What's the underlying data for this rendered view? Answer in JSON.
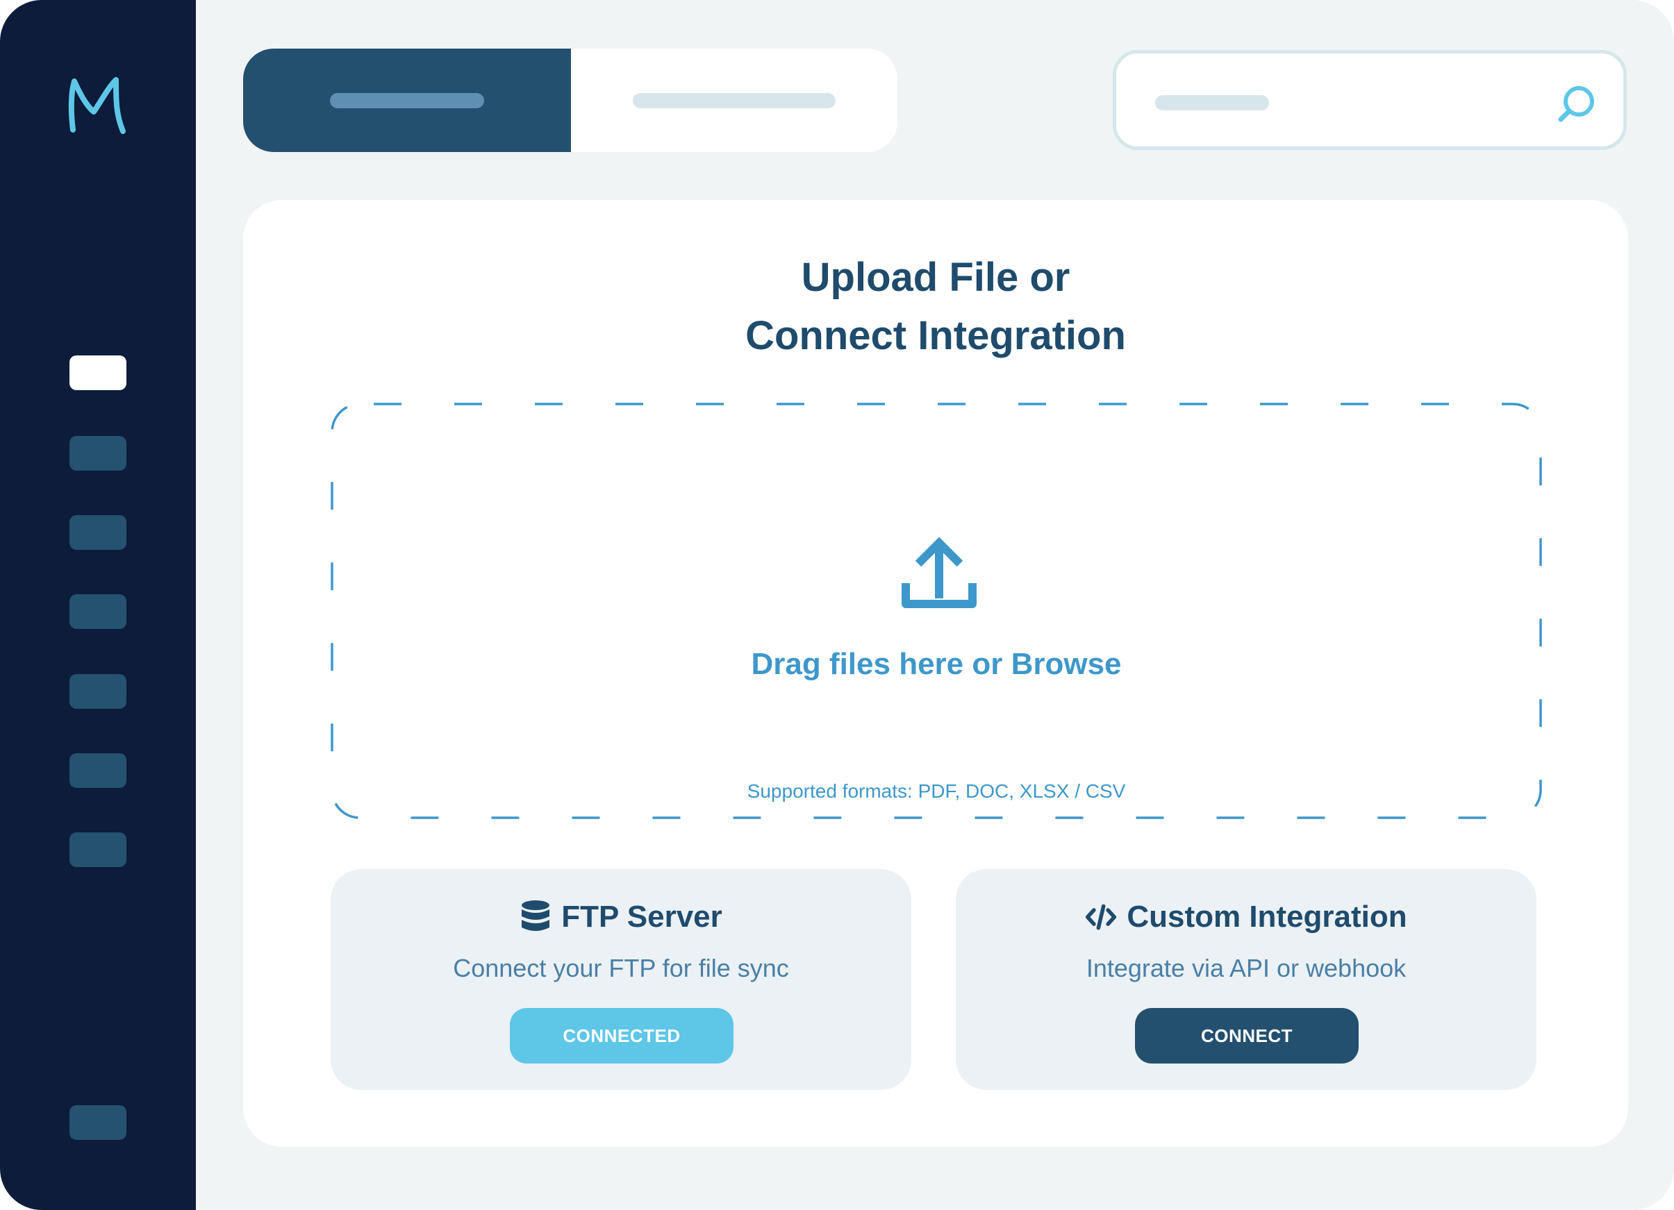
{
  "sidebar": {
    "logo": "M",
    "nav_items": [
      "nav-item-1",
      "nav-item-2",
      "nav-item-3",
      "nav-item-4",
      "nav-item-5",
      "nav-item-6",
      "nav-item-7",
      "nav-item-bottom"
    ],
    "active_index": 0
  },
  "header": {
    "tabs": [
      {
        "state": "selected"
      },
      {
        "state": "unselected"
      }
    ],
    "search": {
      "icon": "search-icon"
    }
  },
  "main": {
    "title_line1": "Upload File or",
    "title_line2": "Connect Integration",
    "dropzone": {
      "icon": "upload-icon",
      "prompt": "Drag files here or Browse",
      "formats": "Supported formats: PDF, DOC, XLSX / CSV"
    },
    "integrations": [
      {
        "icon": "database-icon",
        "title": "FTP Server",
        "description": "Connect your FTP for file sync",
        "button_label": "CONNECTED",
        "status": "connected"
      },
      {
        "icon": "code-icon",
        "title": "Custom Integration",
        "description": "Integrate via API or webhook",
        "button_label": "CONNECT",
        "status": "not-connected"
      }
    ]
  },
  "colors": {
    "sidebar": "#0c1c3a",
    "primary": "#23506f",
    "accent": "#3d97cb",
    "connected": "#5ec6e6",
    "background": "#f0f4f5"
  }
}
